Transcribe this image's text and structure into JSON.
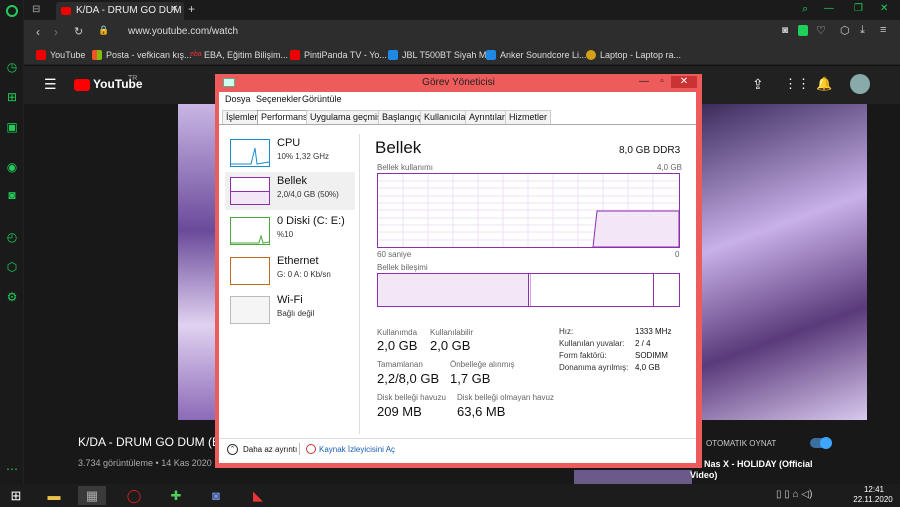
{
  "browser": {
    "tab_title": "K/DA - DRUM GO DUM (Be",
    "new_tab": "+",
    "url": "www.youtube.com/watch",
    "bookmarks": [
      "YouTube",
      "Posta - vefkican kış...",
      "EBA, Eğitim Bilişim...",
      "PintiPanda TV - Yo...",
      "JBL T500BT Siyah M...",
      "Anker Soundcore Li...",
      "Laptop - Laptop ra..."
    ]
  },
  "youtube": {
    "logo": "YouTube",
    "logo_sup": "TR",
    "video_title": "K/DA - DRUM GO DUM (Ba",
    "views": "3.734 görüntüleme • 14 Kas 2020",
    "autoplay": "OTOMATIK OYNAT",
    "next_video": "Nas X - HOLIDAY (Official",
    "next_video_2": "Video)"
  },
  "taskmgr": {
    "title": "Görev Yöneticisi",
    "menu": [
      "Dosya",
      "Seçenekler",
      "Görüntüle"
    ],
    "tabs": [
      "İşlemler",
      "Performans",
      "Uygulama geçmişi",
      "Başlangıç",
      "Kullanıcılar",
      "Ayrıntılar",
      "Hizmetler"
    ],
    "resources": [
      {
        "name": "CPU",
        "sub": "10% 1,32 GHz"
      },
      {
        "name": "Bellek",
        "sub": "2,0/4,0 GB (50%)"
      },
      {
        "name": "0 Diski (C: E:)",
        "sub": "%10"
      },
      {
        "name": "Ethernet",
        "sub": "G: 0 A: 0 Kb/sn"
      },
      {
        "name": "Wi-Fi",
        "sub": "Bağlı değil"
      }
    ],
    "heading": "Bellek",
    "spec": "8,0 GB DDR3",
    "usage_label": "Bellek kullanımı",
    "usage_max": "4,0 GB",
    "axis_left": "60 saniye",
    "axis_right": "0",
    "composition_label": "Bellek bileşimi",
    "usage_fraction": 0.5,
    "stats": {
      "in_use_label": "Kullanımda",
      "in_use": "2,0 GB",
      "available_label": "Kullanılabilir",
      "available": "2,0 GB",
      "committed_label": "Tamamlanan",
      "committed": "2,2/8,0 GB",
      "cached_label": "Önbelleğe alınmış",
      "cached": "1,7 GB",
      "paged_label": "Disk belleği havuzu",
      "paged": "209 MB",
      "nonpaged_label": "Disk belleği olmayan havuz",
      "nonpaged": "63,6 MB"
    },
    "props": [
      {
        "k": "Hız:",
        "v": "1333 MHz"
      },
      {
        "k": "Kullanılan yuvalar:",
        "v": "2 / 4"
      },
      {
        "k": "Form faktörü:",
        "v": "SODIMM"
      },
      {
        "k": "Donanıma ayrılmış:",
        "v": "4,0 GB"
      }
    ],
    "fewer_details": "Daha az ayrıntı",
    "resource_monitor": "Kaynak İzleyicisini Aç"
  },
  "clock": {
    "time": "12:41",
    "date": "22.11.2020"
  }
}
